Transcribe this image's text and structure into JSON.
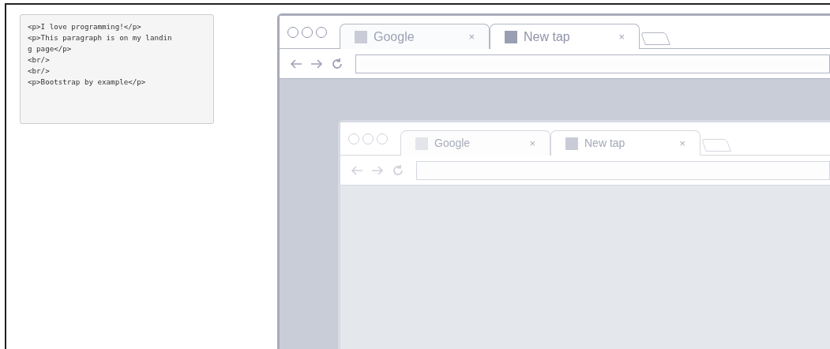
{
  "code_sample": {
    "lines": [
      "<p>I love programming!</p>",
      "<p>This paragraph is on my landin",
      "g page</p>",
      "<br/>",
      "<br/>",
      "<p>Bootstrap by example</p>"
    ]
  },
  "browser": {
    "tabs": [
      {
        "label": "Google",
        "close": "×",
        "selected": false
      },
      {
        "label": "New tap",
        "close": "×",
        "selected": true
      }
    ],
    "content": {
      "browser": {
        "tabs": [
          {
            "label": "Google",
            "close": "×",
            "selected": false
          },
          {
            "label": "New tap",
            "close": "×",
            "selected": true
          }
        ]
      }
    }
  }
}
